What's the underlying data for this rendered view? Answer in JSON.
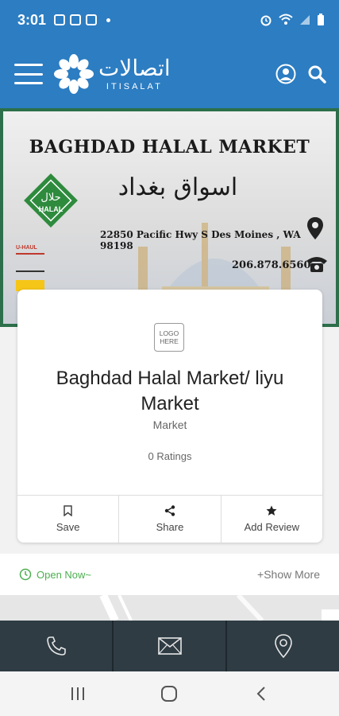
{
  "status": {
    "time": "3:01"
  },
  "app": {
    "logo_arabic": "اتصالات",
    "logo_english": "ITISALAT"
  },
  "banner": {
    "title": "BAGHDAD HALAL MARKET",
    "arabic": "اسواق بغداد",
    "badge_arabic": "حلال",
    "badge_text": "HALAL",
    "address": "22850 Pacific Hwy S Des Moines , WA 98198",
    "phone": "206.878.6560",
    "brand_tag": "U-HAUL"
  },
  "card": {
    "logo_placeholder": "LOGO HERE",
    "name": "Baghdad Halal Market/ liyu Market",
    "category": "Market",
    "ratings": "0 Ratings",
    "actions": [
      {
        "label": "Save",
        "icon": "bookmark-icon"
      },
      {
        "label": "Share",
        "icon": "share-icon"
      },
      {
        "label": "Add Review",
        "icon": "star-icon"
      }
    ]
  },
  "hours": {
    "status": "Open Now~",
    "show_more": "+Show More"
  },
  "colors": {
    "primary": "#2c7dc2",
    "open": "#4caf50",
    "bottom_bar": "#2f3c44"
  }
}
